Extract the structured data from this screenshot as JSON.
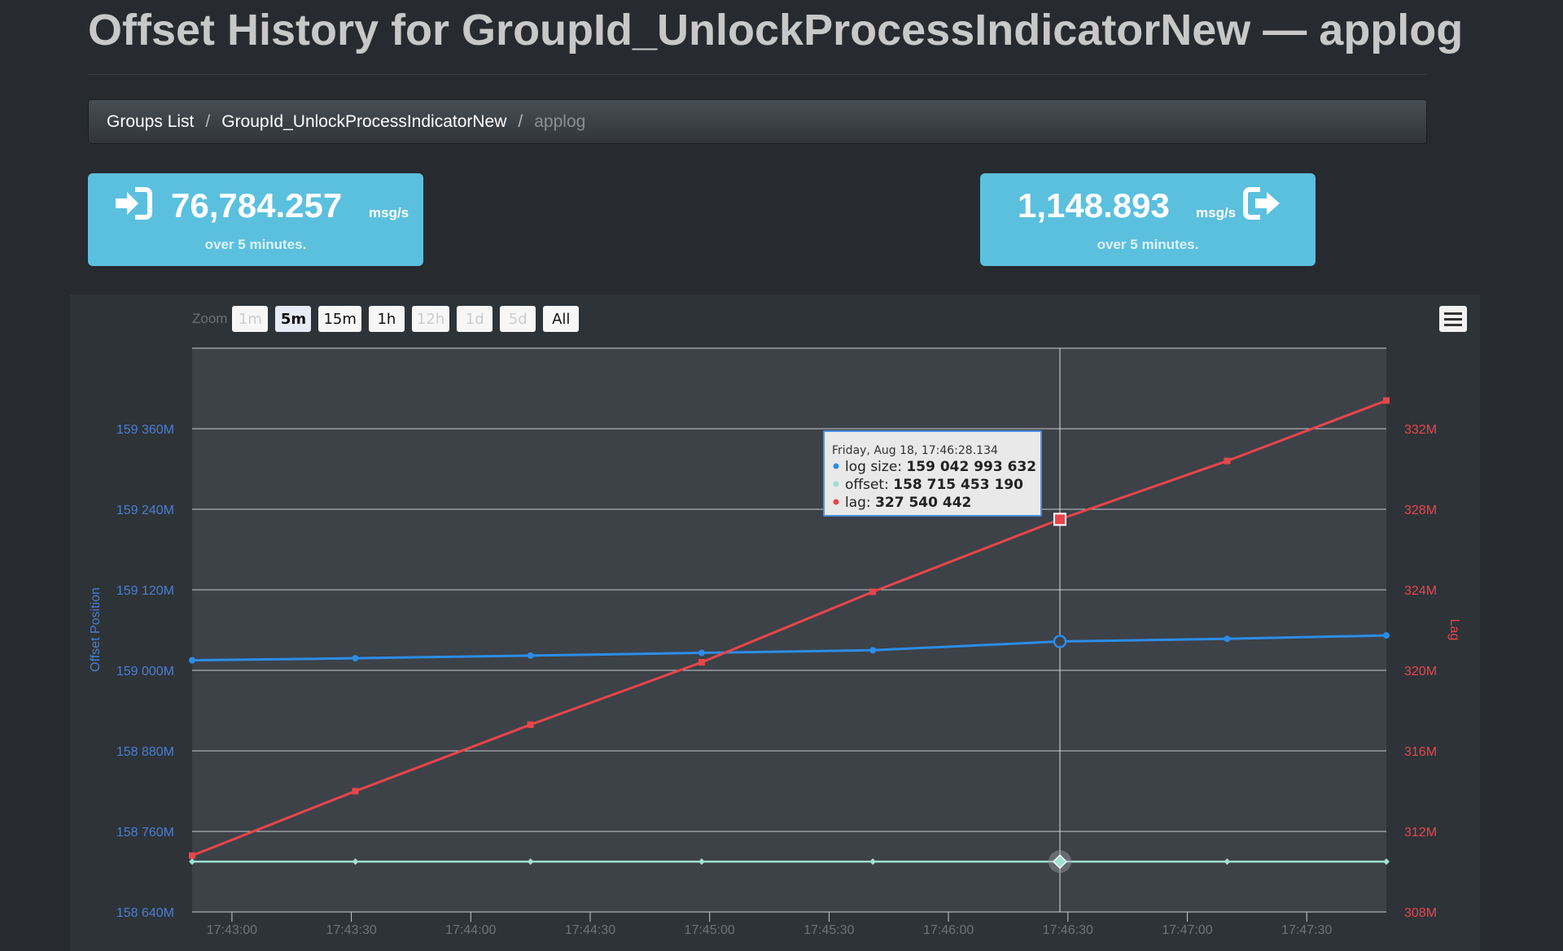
{
  "page": {
    "title": "Offset History for GroupId_UnlockProcessIndicatorNew — applog"
  },
  "breadcrumb": {
    "items": [
      "Groups List",
      "GroupId_UnlockProcessIndicatorNew"
    ],
    "active": "applog",
    "separator": "/"
  },
  "rates": {
    "in": {
      "value": "76,784.257",
      "unit": "msg/s",
      "sub": "over 5 minutes.",
      "icon": "sign-in-icon"
    },
    "out": {
      "value": "1,148.893",
      "unit": "msg/s",
      "sub": "over 5 minutes.",
      "icon": "sign-out-icon"
    }
  },
  "colors": {
    "accent_box": "#5bc0de",
    "log_size": "#2b8de8",
    "offset": "#9fe0d0",
    "lag": "#e8454b"
  },
  "zoom": {
    "label": "Zoom",
    "buttons": [
      {
        "label": "1m",
        "state": "disabled"
      },
      {
        "label": "5m",
        "state": "selected"
      },
      {
        "label": "15m",
        "state": "normal"
      },
      {
        "label": "1h",
        "state": "normal"
      },
      {
        "label": "12h",
        "state": "disabled"
      },
      {
        "label": "1d",
        "state": "disabled"
      },
      {
        "label": "5d",
        "state": "disabled"
      },
      {
        "label": "All",
        "state": "normal"
      }
    ]
  },
  "tooltip": {
    "date": "Friday, Aug 18, 17:46:28.134",
    "rows": [
      {
        "label": "log size:",
        "value": "159 042 993 632",
        "series": "log size"
      },
      {
        "label": "offset:",
        "value": "158 715 453 190",
        "series": "offset"
      },
      {
        "label": "lag:",
        "value": "327 540 442",
        "series": "lag"
      }
    ]
  },
  "chart_data": {
    "type": "line",
    "title": "",
    "xlabel": "",
    "y_left_label": "Offset Position",
    "y_right_label": "Lag",
    "x_tick_labels": [
      "17:43:00",
      "17:43:30",
      "17:44:00",
      "17:44:30",
      "17:45:00",
      "17:45:30",
      "17:46:00",
      "17:46:30",
      "17:47:00",
      "17:47:30"
    ],
    "y_left_ticks": [
      "158 640M",
      "158 760M",
      "158 880M",
      "159 000M",
      "159 120M",
      "159 240M",
      "159 360M"
    ],
    "y_right_ticks": [
      "308M",
      "312M",
      "316M",
      "320M",
      "324M",
      "328M",
      "332M"
    ],
    "y_left_range_millions": [
      158640,
      159480
    ],
    "y_right_range_millions": [
      308,
      320
    ],
    "x_range": [
      "17:42:50",
      "17:47:50"
    ],
    "grid": true,
    "legend": "none",
    "hovered_x": "17:46:28",
    "series": [
      {
        "name": "log size",
        "axis": "left",
        "unit": "millions",
        "x": [
          "17:42:50",
          "17:43:31",
          "17:44:15",
          "17:44:58",
          "17:45:41",
          "17:46:28",
          "17:47:10",
          "17:47:50"
        ],
        "y": [
          159015,
          159018,
          159022,
          159026,
          159030,
          159043,
          159047,
          159052
        ]
      },
      {
        "name": "offset",
        "axis": "left",
        "unit": "millions",
        "x": [
          "17:42:50",
          "17:43:31",
          "17:44:15",
          "17:44:58",
          "17:45:41",
          "17:46:28",
          "17:47:10",
          "17:47:50"
        ],
        "y": [
          158715,
          158715,
          158715,
          158715,
          158715,
          158715,
          158715,
          158715
        ]
      },
      {
        "name": "lag",
        "axis": "right",
        "unit": "millions",
        "x": [
          "17:42:50",
          "17:43:31",
          "17:44:15",
          "17:44:58",
          "17:45:41",
          "17:46:28",
          "17:47:10",
          "17:47:50"
        ],
        "y": [
          310.8,
          314.0,
          317.3,
          320.4,
          323.9,
          327.5,
          330.4,
          333.4
        ]
      }
    ]
  }
}
